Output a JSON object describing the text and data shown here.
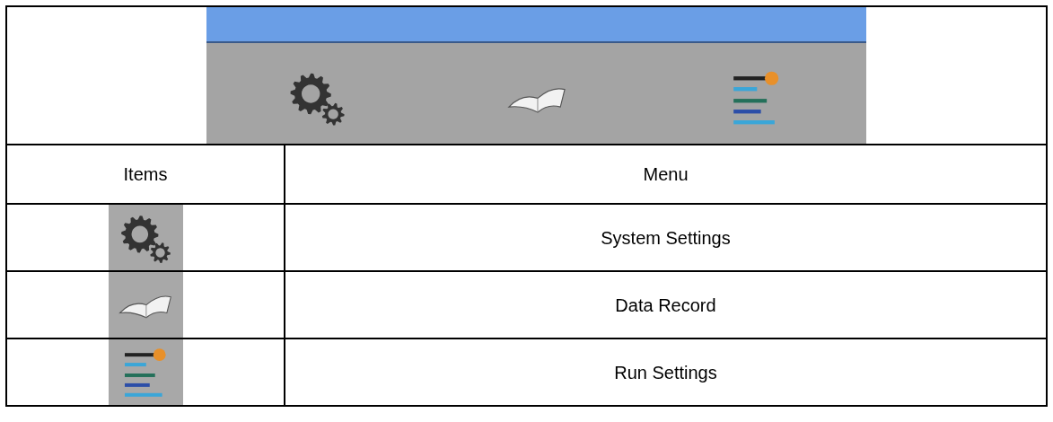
{
  "toolbar": {
    "items": [
      {
        "kind": "gears"
      },
      {
        "kind": "book"
      },
      {
        "kind": "levels"
      }
    ]
  },
  "table": {
    "columns": [
      "Items",
      "Menu"
    ],
    "rows": [
      {
        "kind": "gears",
        "menu": "System Settings"
      },
      {
        "kind": "book",
        "menu": "Data Record"
      },
      {
        "kind": "levels",
        "menu": "Run Settings"
      }
    ]
  }
}
